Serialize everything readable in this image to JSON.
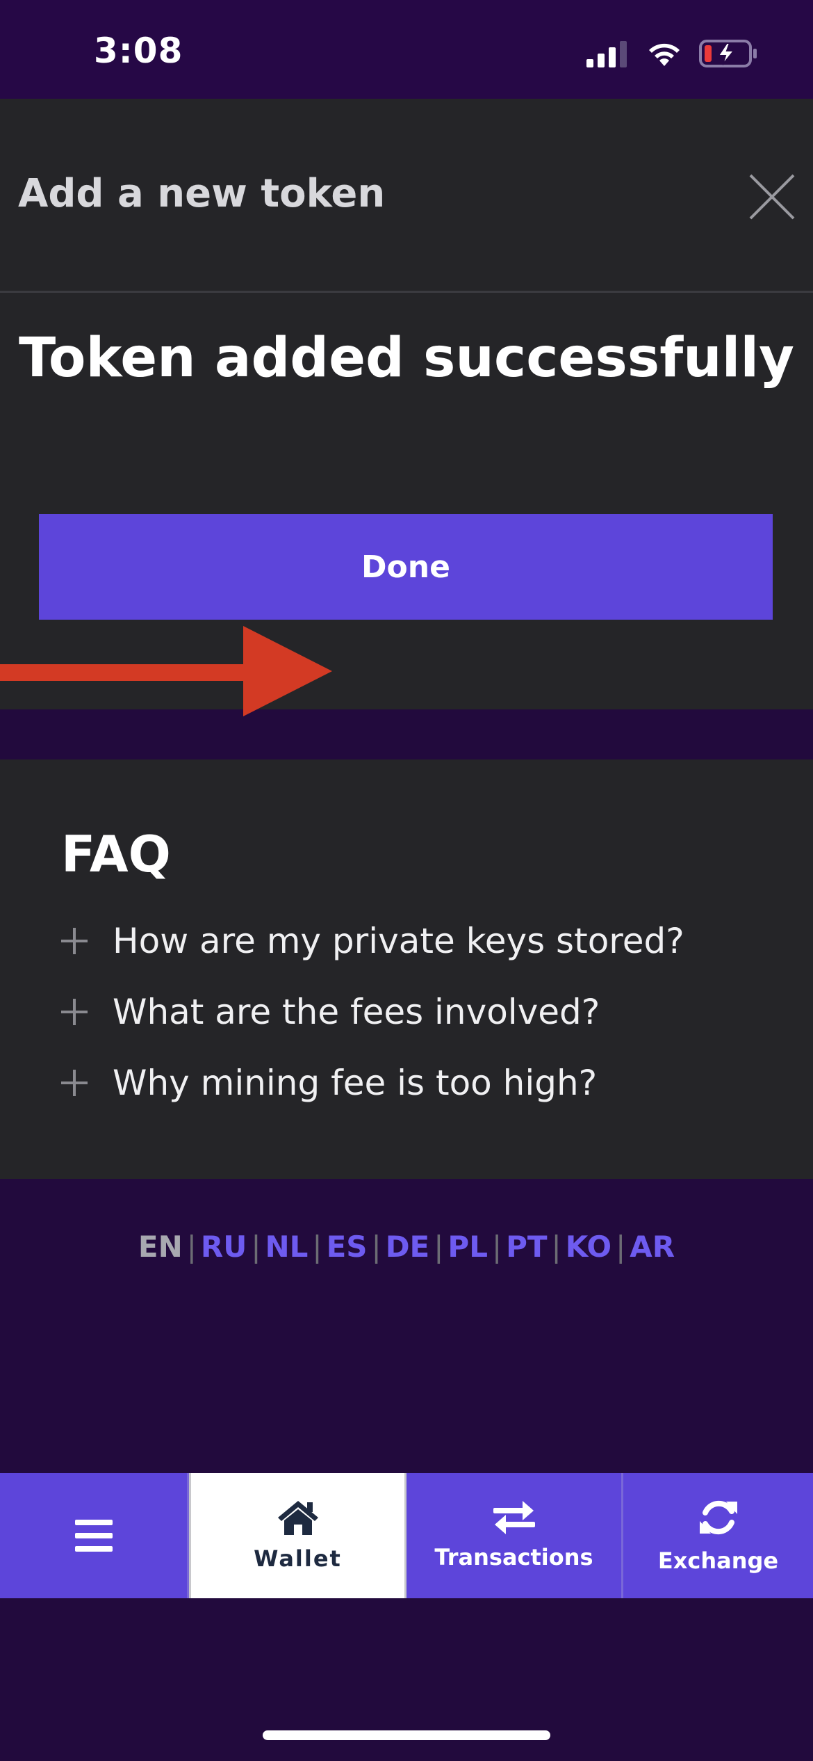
{
  "status_bar": {
    "time": "3:08"
  },
  "modal": {
    "title": "Add a new token",
    "close_icon": "close-icon",
    "success_message": "Token added successfully",
    "done_label": "Done"
  },
  "faq": {
    "title": "FAQ",
    "items": [
      {
        "label": "How are my private keys stored?"
      },
      {
        "label": "What are the fees involved?"
      },
      {
        "label": "Why mining fee is too high?"
      }
    ]
  },
  "languages": {
    "active": "EN",
    "items": [
      "EN",
      "RU",
      "NL",
      "ES",
      "DE",
      "PL",
      "PT",
      "KO",
      "AR"
    ]
  },
  "bottom_nav": {
    "items": [
      {
        "label": "",
        "icon": "hamburger-menu-icon"
      },
      {
        "label": "Wallet",
        "icon": "home-icon"
      },
      {
        "label": "Transactions",
        "icon": "transfer-arrows-icon"
      },
      {
        "label": "Exchange",
        "icon": "refresh-icon"
      }
    ],
    "active": "Wallet"
  },
  "colors": {
    "accent": "#5d45da",
    "background": "#220a3d",
    "panel": "#252528",
    "annotation_arrow": "#d33a24"
  }
}
